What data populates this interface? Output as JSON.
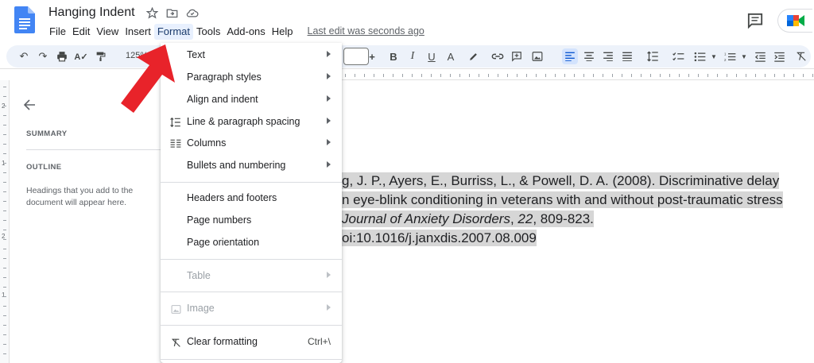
{
  "app": {
    "doc_title": "Hanging Indent",
    "last_edit": "Last edit was seconds ago"
  },
  "menubar": {
    "items": [
      "File",
      "Edit",
      "View",
      "Insert",
      "Format",
      "Tools",
      "Add-ons",
      "Help"
    ],
    "active": "Format"
  },
  "toolbar": {
    "zoom": "125%",
    "accent_color": "#1a73e8"
  },
  "outline": {
    "summary_label": "SUMMARY",
    "outline_label": "OUTLINE",
    "hint": "Headings that you add to the document will appear here."
  },
  "ruler": {
    "vertical_labels": [
      "2",
      "1",
      "1",
      "2"
    ]
  },
  "document": {
    "line1": "g, J. P., Ayers, E., Burriss, L., & Powell, D. A. (2008). Discriminative delay",
    "line2": "n eye-blink conditioning in veterans with and without post-traumatic stress",
    "line3_italic": "Journal of Anxiety Disorders",
    "line3_sep": ", ",
    "line3_italic2": "22",
    "line3_rest": ", 809-823.",
    "line4": "oi:10.1016/j.janxdis.2007.08.009"
  },
  "format_menu": {
    "text": "Text",
    "paragraph_styles": "Paragraph styles",
    "align_indent": "Align and indent",
    "line_spacing": "Line & paragraph spacing",
    "columns": "Columns",
    "bullets": "Bullets and numbering",
    "headers_footers": "Headers and footers",
    "page_numbers": "Page numbers",
    "page_orientation": "Page orientation",
    "table": "Table",
    "image": "Image",
    "clear_formatting": "Clear formatting",
    "clear_shortcut": "Ctrl+\\"
  },
  "colors": {
    "arrow": "#e8232a",
    "highlight": "#d6d6d6",
    "menu_active_bg": "#e8f0fe"
  }
}
